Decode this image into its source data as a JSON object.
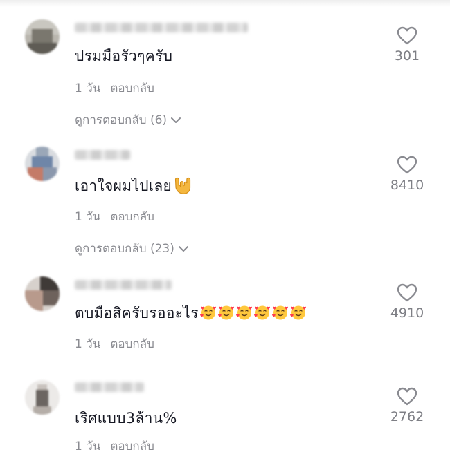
{
  "comments": [
    {
      "text": "ปรมมือรัวๆครับ",
      "time": "1 วัน",
      "reply_label": "ตอบกลับ",
      "view_replies": "ดูการตอบกลับ (6)",
      "likes": "301",
      "username_redacted": true
    },
    {
      "text": "เอาใจผมไปเลย",
      "time": "1 วัน",
      "reply_label": "ตอบกลับ",
      "view_replies": "ดูการตอบกลับ (23)",
      "likes": "8410",
      "emoji": [
        "rock-on-hand-icon"
      ],
      "username_redacted": true
    },
    {
      "text": "ตบมือสิครับรออะไร",
      "time": "1 วัน",
      "reply_label": "ตอบกลับ",
      "likes": "4910",
      "emoji": [
        "smiling-face-with-hearts-icon",
        "smiling-face-with-hearts-icon",
        "smiling-face-with-hearts-icon",
        "smiling-face-with-hearts-icon",
        "smiling-face-with-hearts-icon",
        "smiling-face-with-hearts-icon"
      ],
      "username_redacted": true
    },
    {
      "text": "เริศแบบ3ล้าน%",
      "time": "1 วัน",
      "reply_label": "ตอบกลับ",
      "likes": "2762",
      "username_redacted": true
    }
  ],
  "colors": {
    "text": "#161823",
    "secondary": "#8a8b91",
    "like_count": "#7e7f85",
    "heart_outline": "#8a8b91"
  }
}
